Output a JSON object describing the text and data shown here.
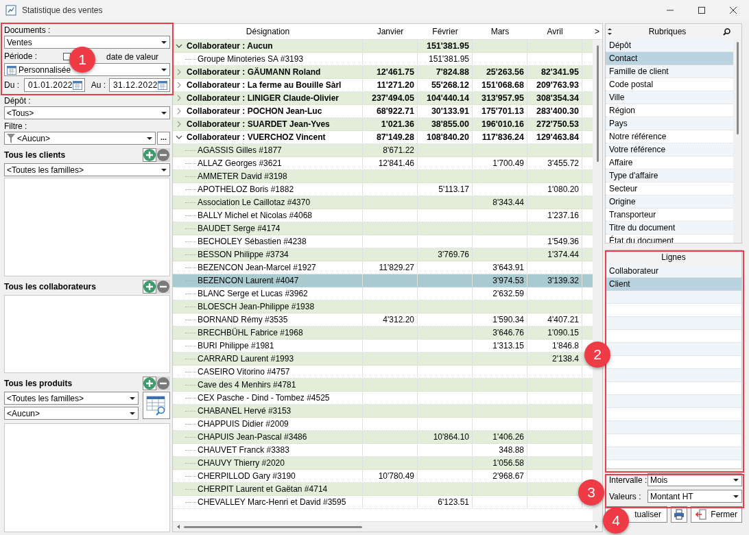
{
  "window": {
    "title": "Statistique des ventes"
  },
  "filters": {
    "documents": {
      "label": "Documents :",
      "value": "Ventes"
    },
    "period": {
      "label": "Période :",
      "value": "Personnalisée"
    },
    "value_date": {
      "label": "date de valeur",
      "checked": false
    },
    "from": {
      "label": "Du :",
      "value": "01.01.2022"
    },
    "to": {
      "label": "Au :",
      "value": "31.12.2022"
    },
    "depot": {
      "label": "Dépôt :",
      "value": "<Tous>"
    },
    "filter": {
      "label": "Filtre :",
      "value": "<Aucun>",
      "more": "..."
    }
  },
  "clients": {
    "title": "Tous les clients",
    "family": "<Toutes les familles>"
  },
  "collaborators": {
    "title": "Tous les collaborateurs"
  },
  "products": {
    "title": "Tous les produits",
    "family": "<Toutes les familles>",
    "item": "<Aucun>"
  },
  "table": {
    "columns": [
      "Désignation",
      "Janvier",
      "Février",
      "Mars",
      "Avril"
    ],
    "next": ">",
    "rows": [
      {
        "kind": "group",
        "expanded": true,
        "selected": false,
        "cells": [
          "Collaborateur : Aucun",
          null,
          "151'381.95",
          null,
          null
        ],
        "children": [
          {
            "kind": "item",
            "selected": false,
            "cells": [
              "Groupe Minoteries SA #3193",
              null,
              "151'381.95",
              null,
              null
            ]
          }
        ]
      },
      {
        "kind": "group",
        "expanded": false,
        "selected": false,
        "cells": [
          "Collaborateur : GÄUMANN Roland",
          "12'461.75",
          "7'824.88",
          "25'263.56",
          "82'341.95"
        ]
      },
      {
        "kind": "group",
        "expanded": false,
        "selected": false,
        "cells": [
          "Collaborateur : La ferme au Bouille Sàrl",
          "11'271.20",
          "55'268.12",
          "151'068.68",
          "209'763.93"
        ]
      },
      {
        "kind": "group",
        "expanded": false,
        "selected": false,
        "cells": [
          "Collaborateur : LINIGER Claude-Olivier",
          "237'494.05",
          "104'440.14",
          "313'957.95",
          "308'354.34"
        ]
      },
      {
        "kind": "group",
        "expanded": false,
        "selected": false,
        "cells": [
          "Collaborateur : POCHON Jean-Luc",
          "68'922.71",
          "30'133.91",
          "175'701.13",
          "283'400.30"
        ]
      },
      {
        "kind": "group",
        "expanded": false,
        "selected": false,
        "cells": [
          "Collaborateur : SUARDET Jean-Yves",
          "1'021.36",
          "38'855.00",
          "196'010.16",
          "272'750.53"
        ]
      },
      {
        "kind": "group",
        "expanded": true,
        "selected": false,
        "cells": [
          "Collaborateur : VUERCHOZ Vincent",
          "87'149.28",
          "108'840.20",
          "117'836.24",
          "129'463.84"
        ],
        "children": [
          {
            "kind": "item",
            "selected": false,
            "cells": [
              "AGASSIS Gilles #1877",
              "8'671.22",
              null,
              null,
              null
            ]
          },
          {
            "kind": "item",
            "selected": false,
            "cells": [
              "ALLAZ Georges #3621",
              "12'841.46",
              null,
              "1'700.49",
              "3'455.72"
            ]
          },
          {
            "kind": "item",
            "selected": false,
            "cells": [
              "AMMETER David #3198",
              null,
              null,
              null,
              null
            ]
          },
          {
            "kind": "item",
            "selected": false,
            "cells": [
              "APOTHELOZ Boris #1882",
              null,
              "5'113.17",
              null,
              "1'080.20"
            ]
          },
          {
            "kind": "item",
            "selected": false,
            "cells": [
              "Association Le Caillotaz #4370",
              null,
              null,
              "8'343.44",
              null
            ]
          },
          {
            "kind": "item",
            "selected": false,
            "cells": [
              "BALLY Michel et Nicolas #4068",
              null,
              null,
              null,
              "1'237.16"
            ]
          },
          {
            "kind": "item",
            "selected": false,
            "cells": [
              "BAUDET Serge #4174",
              null,
              null,
              null,
              null
            ]
          },
          {
            "kind": "item",
            "selected": false,
            "cells": [
              "BECHOLEY Sébastien #4238",
              null,
              null,
              null,
              "1'549.36"
            ]
          },
          {
            "kind": "item",
            "selected": false,
            "cells": [
              "BESSON Philippe #3734",
              null,
              "3'769.76",
              null,
              "1'374.44"
            ]
          },
          {
            "kind": "item",
            "selected": false,
            "cells": [
              "BEZENCON Jean-Marcel #1927",
              "11'829.27",
              null,
              "3'643.91",
              null
            ]
          },
          {
            "kind": "item",
            "selected": true,
            "cells": [
              "BEZENCON Laurent #4047",
              null,
              null,
              "3'974.53",
              "3'139.32"
            ]
          },
          {
            "kind": "item",
            "selected": false,
            "cells": [
              "BLANC Serge et Lucas #3962",
              null,
              null,
              "2'632.59",
              null
            ]
          },
          {
            "kind": "item",
            "selected": false,
            "cells": [
              "BLOESCH Jean-Philippe #1938",
              null,
              null,
              null,
              null
            ]
          },
          {
            "kind": "item",
            "selected": false,
            "cells": [
              "BORNAND Rémy #3535",
              "4'312.20",
              null,
              "1'590.34",
              "4'407.21"
            ]
          },
          {
            "kind": "item",
            "selected": false,
            "cells": [
              "BRECHBÜHL Fabrice #1968",
              null,
              null,
              "3'646.76",
              "1'090.15"
            ]
          },
          {
            "kind": "item",
            "selected": false,
            "cells": [
              "BURI Philippe #1981",
              null,
              null,
              "1'313.15",
              "1'846.8"
            ]
          },
          {
            "kind": "item",
            "selected": false,
            "cells": [
              "CARRARD Laurent #1993",
              null,
              null,
              null,
              "2'138.4"
            ]
          },
          {
            "kind": "item",
            "selected": false,
            "cells": [
              "CASEIRO Vitorino #4757",
              null,
              null,
              null,
              null
            ]
          },
          {
            "kind": "item",
            "selected": false,
            "cells": [
              "Cave des 4 Menhirs #4781",
              null,
              null,
              null,
              null
            ]
          },
          {
            "kind": "item",
            "selected": false,
            "cells": [
              "CEX Pasche - Dind - Tombez #4525",
              null,
              null,
              null,
              null
            ]
          },
          {
            "kind": "item",
            "selected": false,
            "cells": [
              "CHABANEL Hervé #3153",
              null,
              null,
              null,
              null
            ]
          },
          {
            "kind": "item",
            "selected": false,
            "cells": [
              "CHAPPUIS Didier #2009",
              null,
              null,
              null,
              null
            ]
          },
          {
            "kind": "item",
            "selected": false,
            "cells": [
              "CHAPUIS Jean-Pascal #3486",
              null,
              "10'864.10",
              "1'406.26",
              null
            ]
          },
          {
            "kind": "item",
            "selected": false,
            "cells": [
              "CHAUVET Franck #3383",
              null,
              null,
              "348.88",
              null
            ]
          },
          {
            "kind": "item",
            "selected": false,
            "cells": [
              "CHAUVY Thierry #2020",
              null,
              null,
              "1'056.58",
              null
            ]
          },
          {
            "kind": "item",
            "selected": false,
            "cells": [
              "CHERPILLOD Gary #3190",
              "10'780.49",
              null,
              "2'968.67",
              null
            ]
          },
          {
            "kind": "item",
            "selected": false,
            "cells": [
              "CHERPIT Laurent et Gaëtan #4714",
              null,
              null,
              null,
              null
            ]
          },
          {
            "kind": "item",
            "selected": false,
            "cells": [
              "CHEVALLEY Marc-Henri et David #3595",
              null,
              "6'123.51",
              null,
              null
            ]
          }
        ]
      }
    ]
  },
  "rubriques": {
    "title": "Rubriques",
    "items": [
      {
        "label": "Dépôt",
        "selected": false
      },
      {
        "label": "Contact",
        "selected": true
      },
      {
        "label": "Famille de client",
        "selected": false
      },
      {
        "label": "Code postal",
        "selected": false
      },
      {
        "label": "Ville",
        "selected": false
      },
      {
        "label": "Région",
        "selected": false
      },
      {
        "label": "Pays",
        "selected": false
      },
      {
        "label": "Notre référence",
        "selected": false
      },
      {
        "label": "Votre référence",
        "selected": false
      },
      {
        "label": "Affaire",
        "selected": false
      },
      {
        "label": "Type d'affaire",
        "selected": false
      },
      {
        "label": "Secteur",
        "selected": false
      },
      {
        "label": "Origine",
        "selected": false
      },
      {
        "label": "Transporteur",
        "selected": false
      },
      {
        "label": "Titre du document",
        "selected": false
      },
      {
        "label": "État du document",
        "selected": false
      }
    ]
  },
  "lignes": {
    "title": "Lignes",
    "items": [
      {
        "label": "Collaborateur",
        "selected": false
      },
      {
        "label": "Client",
        "selected": true
      }
    ]
  },
  "interval": {
    "label": "Intervalle :",
    "value": "Mois"
  },
  "values": {
    "label": "Valeurs :",
    "value": "Montant HT"
  },
  "buttons": [
    {
      "kind": "refresh",
      "label": "tualiser"
    },
    {
      "kind": "print"
    },
    {
      "kind": "close",
      "label": "Fermer"
    }
  ],
  "callouts": [
    {
      "label": "1"
    },
    {
      "label": "2"
    },
    {
      "label": "3"
    },
    {
      "label": "4"
    }
  ]
}
